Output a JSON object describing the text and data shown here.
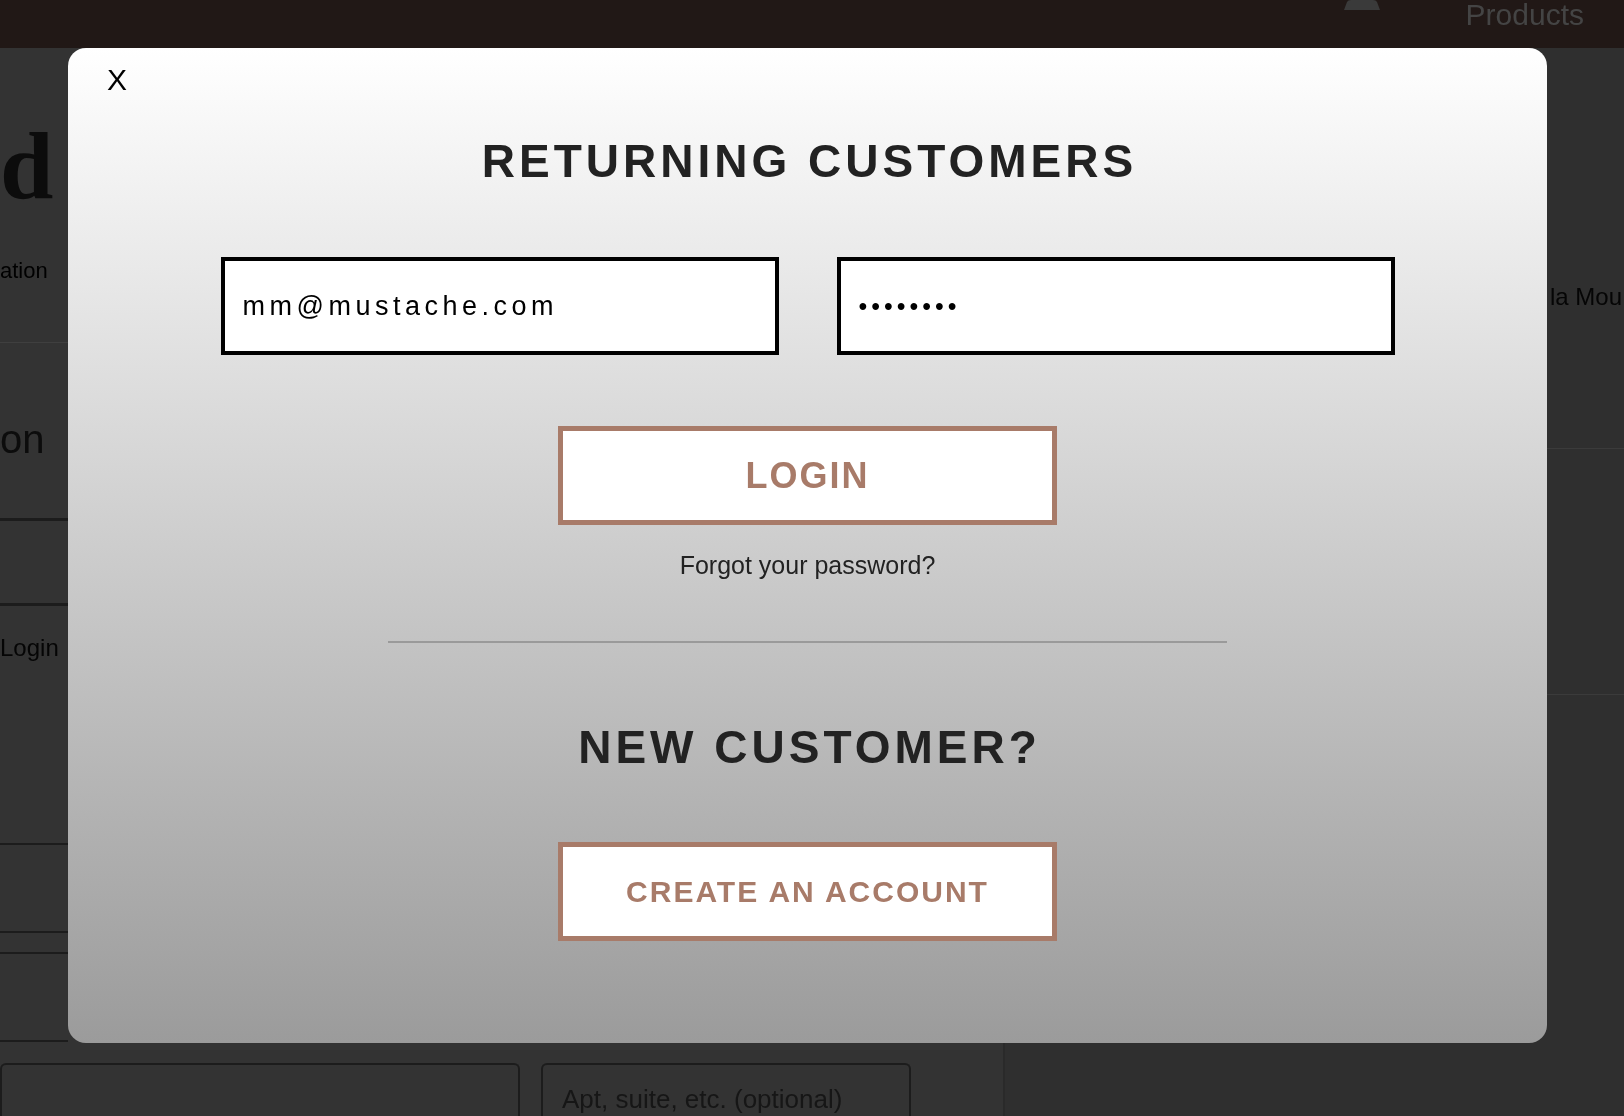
{
  "header": {
    "nav_link": "Products"
  },
  "checkout": {
    "logo": "d",
    "breadcrumb": "ation",
    "section_heading": "on",
    "login_link": "Login",
    "apartment_field": {
      "placeholder": "Apt, suite, etc. (optional)"
    }
  },
  "order_summary": {
    "item_name": "la Mou"
  },
  "login_modal": {
    "close": "X",
    "title": "RETURNING CUSTOMERS",
    "email_field": {
      "value": "mm@mustache.com"
    },
    "password_field": {
      "value": "••••••••"
    },
    "login_button": "LOGIN",
    "forgot_link": "Forgot your password?",
    "new_customer_title": "NEW CUSTOMER?",
    "create_account_button": "CREATE AN ACCOUNT"
  }
}
